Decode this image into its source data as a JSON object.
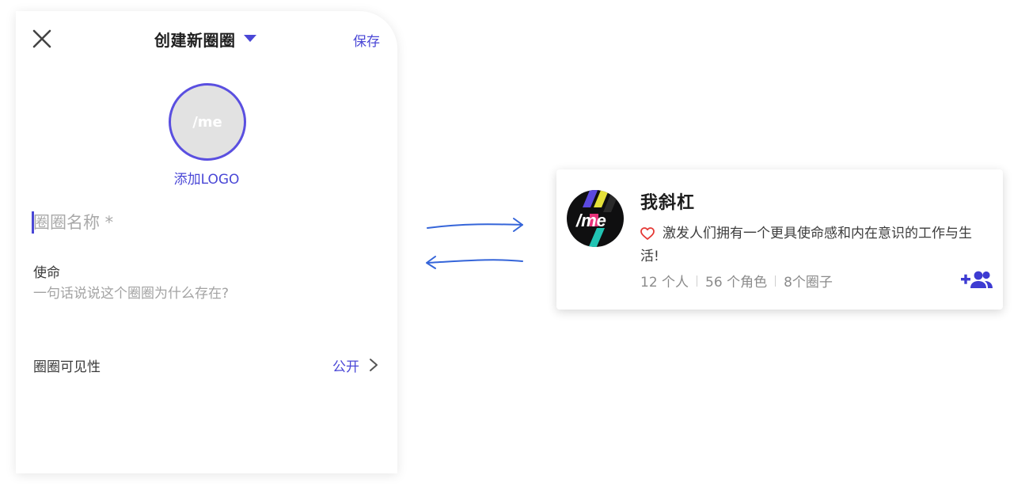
{
  "form": {
    "title": "创建新圈圈",
    "save_label": "保存",
    "logo_placeholder_text": "/me",
    "add_logo_label": "添加LOGO",
    "name_placeholder": "圈圈名称 *",
    "mission_label": "使命",
    "mission_placeholder": "一句话说说这个圈圈为什么存在?",
    "visibility_label": "圈圈可见性",
    "visibility_value": "公开"
  },
  "card": {
    "name": "我斜杠",
    "description": "激发人们拥有一个更具使命感和内在意识的工作与生活!",
    "stats": [
      "12 个人",
      "56 个角色",
      "8个圈子"
    ]
  },
  "icons": {
    "close": "close-icon",
    "dropdown": "caret-down-icon",
    "chevron": "chevron-right-icon",
    "heart": "heart-outline-icon",
    "add_member": "add-member-icon",
    "arrows": "exchange-arrows-icon"
  },
  "colors": {
    "accent": "#4a47d6",
    "arrow": "#3565d9",
    "heart": "#e53935"
  }
}
